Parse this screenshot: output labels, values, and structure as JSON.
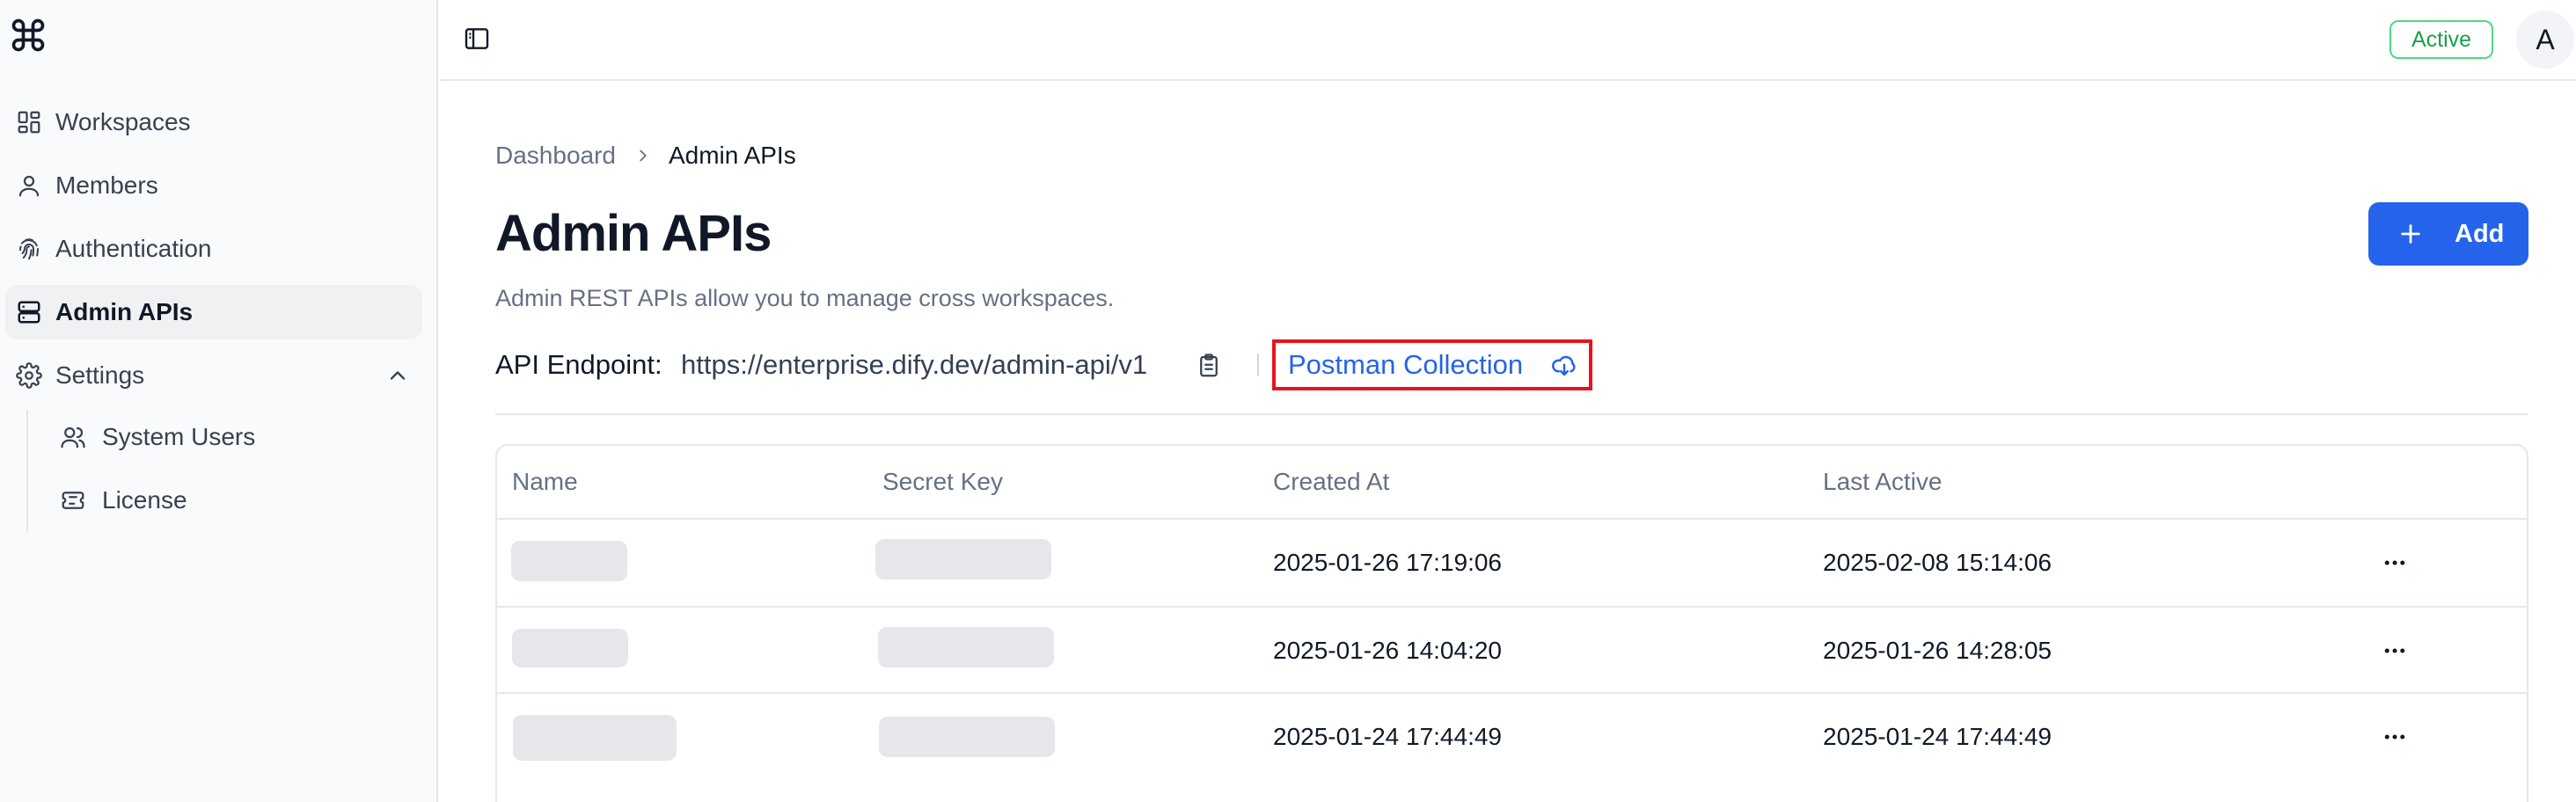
{
  "sidebar": {
    "items": [
      {
        "label": "Workspaces"
      },
      {
        "label": "Members"
      },
      {
        "label": "Authentication"
      },
      {
        "label": "Admin APIs"
      },
      {
        "label": "Settings"
      }
    ],
    "sub_items": [
      {
        "label": "System Users"
      },
      {
        "label": "License"
      }
    ]
  },
  "topbar": {
    "status": "Active",
    "avatar": "A"
  },
  "breadcrumb": {
    "parent": "Dashboard",
    "current": "Admin APIs"
  },
  "page": {
    "title": "Admin APIs",
    "description": "Admin REST APIs allow you to manage cross workspaces.",
    "add_label": "Add"
  },
  "endpoint": {
    "label": "API Endpoint:",
    "url": "https://enterprise.dify.dev/admin-api/v1",
    "postman_label": "Postman Collection"
  },
  "table": {
    "headers": [
      "Name",
      "Secret Key",
      "Created At",
      "Last Active"
    ],
    "rows": [
      {
        "created_at": "2025-01-26 17:19:06",
        "last_active": "2025-02-08 15:14:06"
      },
      {
        "created_at": "2025-01-26 14:04:20",
        "last_active": "2025-01-26 14:28:05"
      },
      {
        "created_at": "2025-01-24 17:44:49",
        "last_active": "2025-01-24 17:44:49"
      }
    ]
  },
  "colors": {
    "accent": "#2563eb",
    "status_green": "#16a34a",
    "highlight_red": "#e5141c"
  },
  "icons": [
    "command-icon",
    "grid-icon",
    "user-icon",
    "fingerprint-icon",
    "server-icon",
    "gear-icon",
    "chevron-up-icon",
    "users-icon",
    "ticket-icon",
    "sidebar-toggle-icon",
    "chevron-right-icon",
    "plus-icon",
    "clipboard-icon",
    "cloud-download-icon",
    "more-horizontal-icon"
  ]
}
